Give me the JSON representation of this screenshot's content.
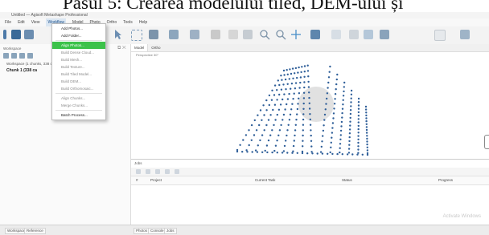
{
  "caption": "Pasul 5: Crearea modelului tiled, DEM-ului și",
  "window": {
    "title": "Untitled — Agisoft Metashape Professional"
  },
  "menu": {
    "items": [
      "File",
      "Edit",
      "View",
      "Workflow",
      "Model",
      "Photo",
      "Ortho",
      "Tools",
      "Help"
    ],
    "active_index": 3
  },
  "workspace": {
    "header": "Workspace",
    "root": "Workspace (1 chunks, 338 cameras)",
    "chunk": "Chunk 1 (338 ca"
  },
  "workflow_menu": {
    "items": [
      {
        "label": "Add Photos...",
        "state": "enabled"
      },
      {
        "label": "Add Folder...",
        "state": "enabled"
      },
      {
        "label": "Align Photos...",
        "state": "highlighted"
      },
      {
        "label": "Build Dense Cloud...",
        "state": "disabled"
      },
      {
        "label": "Build Mesh...",
        "state": "disabled"
      },
      {
        "label": "Build Texture...",
        "state": "disabled"
      },
      {
        "label": "Build Tiled Model...",
        "state": "disabled"
      },
      {
        "label": "Build DEM...",
        "state": "disabled"
      },
      {
        "label": "Build Orthomosaic...",
        "state": "disabled"
      },
      {
        "label": "Align Chunks...",
        "state": "disabled"
      },
      {
        "label": "Merge Chunks...",
        "state": "disabled"
      },
      {
        "label": "Batch Process...",
        "state": "enabled"
      }
    ]
  },
  "model_view": {
    "tabs": [
      "Model",
      "Ortho"
    ],
    "active_tab": "Model",
    "perspective_label": "Perspective 30°"
  },
  "jobs": {
    "title": "Jobs",
    "columns": [
      "#",
      "Project",
      "Current Task",
      "Status",
      "Progress"
    ]
  },
  "watermark": "Activate Windows",
  "status": {
    "left": [
      "Workspace",
      "Reference"
    ],
    "right": [
      "Photos",
      "Console",
      "Jobs"
    ]
  },
  "colors": {
    "highlight": "#3cc24a",
    "camera_points": "#2f5f99",
    "sphere": "#d9d9d9",
    "accent": "#1a4f8a"
  }
}
